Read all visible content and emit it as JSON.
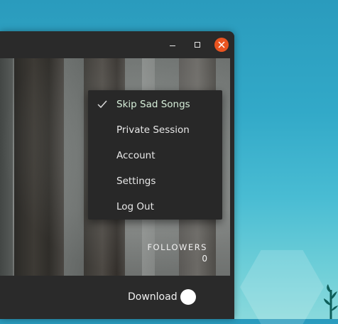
{
  "window": {
    "controls": {
      "minimize_icon": "minimize-icon",
      "maximize_icon": "maximize-icon",
      "close_icon": "close-icon",
      "close_color": "#e95420"
    }
  },
  "profile": {
    "followers_label": "FOLLOWERS",
    "followers_count": "0",
    "menu_toggle_icon": "chevron-down-icon",
    "accent_color": "#1db954"
  },
  "menu": {
    "items": [
      {
        "label": "Skip Sad Songs",
        "checked": true
      },
      {
        "label": "Private Session",
        "checked": false
      },
      {
        "label": "Account",
        "checked": false
      },
      {
        "label": "Settings",
        "checked": false
      },
      {
        "label": "Log Out",
        "checked": false
      }
    ]
  },
  "bottom_bar": {
    "download_label": "Download",
    "download_enabled": false
  }
}
